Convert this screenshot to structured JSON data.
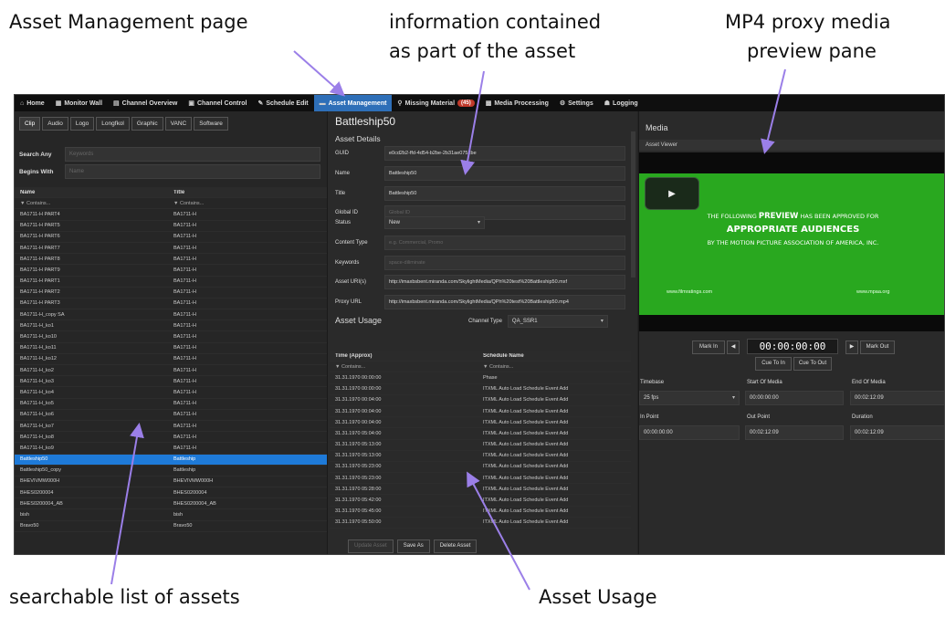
{
  "callouts": {
    "asset_management_page": "Asset Management page",
    "info_line1": "information contained",
    "info_line2": "as part of the asset",
    "proxy_line1": "MP4 proxy media",
    "proxy_line2": "preview pane",
    "searchable_list": "searchable list of assets",
    "asset_usage": "Asset Usage"
  },
  "colors": {
    "accent": "#1e7ad8",
    "annotation_arrow": "#9b7fe8",
    "preview_green": "#29a81f",
    "badge": "#c0392b"
  },
  "nav": {
    "items": [
      {
        "icon": "home-icon",
        "glyph": "⌂",
        "label": "Home"
      },
      {
        "icon": "monitor-wall-icon",
        "glyph": "▦",
        "label": "Monitor Wall"
      },
      {
        "icon": "channel-overview-icon",
        "glyph": "▤",
        "label": "Channel Overview"
      },
      {
        "icon": "channel-control-icon",
        "glyph": "▣",
        "label": "Channel Control"
      },
      {
        "icon": "schedule-edit-icon",
        "glyph": "✎",
        "label": "Schedule Edit"
      },
      {
        "icon": "asset-management-icon",
        "glyph": "▬",
        "label": "Asset Management"
      },
      {
        "icon": "missing-material-icon",
        "glyph": "⚲",
        "label": "Missing Material",
        "badge": "(45)"
      },
      {
        "icon": "media-processing-icon",
        "glyph": "▩",
        "label": "Media Processing"
      },
      {
        "icon": "settings-icon",
        "glyph": "⚙",
        "label": "Settings"
      },
      {
        "icon": "logging-icon",
        "glyph": "☗",
        "label": "Logging"
      }
    ]
  },
  "left": {
    "tabs": [
      "Clip",
      "Audio",
      "Logo",
      "Longfkol",
      "Graphic",
      "VANC",
      "Software"
    ],
    "search_any_label": "Search Any",
    "search_any_placeholder": "Keywords",
    "begins_with_label": "Begins With",
    "begins_with_placeholder": "Name",
    "col_name": "Name",
    "col_title": "Title",
    "filter_name": "▼ Contains...",
    "filter_title": "▼ Contains...",
    "rows": [
      [
        "BA1711-H PART4",
        "BA1711-H"
      ],
      [
        "BA1711-H PART5",
        "BA1711-H"
      ],
      [
        "BA1711-H PART6",
        "BA1711-H"
      ],
      [
        "BA1711-H PART7",
        "BA1711-H"
      ],
      [
        "BA1711-H PART8",
        "BA1711-H"
      ],
      [
        "BA1711-H PART9",
        "BA1711-H"
      ],
      [
        "BA1711-H PART1",
        "BA1711-H"
      ],
      [
        "BA1711-H PART2",
        "BA1711-H"
      ],
      [
        "BA1711-H PART3",
        "BA1711-H"
      ],
      [
        "BA1711-H_copy SA",
        "BA1711-H"
      ],
      [
        "BA1711-H_ko1",
        "BA1711-H"
      ],
      [
        "BA1711-H_ko10",
        "BA1711-H"
      ],
      [
        "BA1711-H_ko11",
        "BA1711-H"
      ],
      [
        "BA1711-H_ko12",
        "BA1711-H"
      ],
      [
        "BA1711-H_ko2",
        "BA1711-H"
      ],
      [
        "BA1711-H_ko3",
        "BA1711-H"
      ],
      [
        "BA1711-H_ko4",
        "BA1711-H"
      ],
      [
        "BA1711-H_ko5",
        "BA1711-H"
      ],
      [
        "BA1711-H_ko6",
        "BA1711-H"
      ],
      [
        "BA1711-H_ko7",
        "BA1711-H"
      ],
      [
        "BA1711-H_ko8",
        "BA1711-H"
      ],
      [
        "BA1711-H_ko9",
        "BA1711-H"
      ],
      [
        "Battleship50",
        "Battleship"
      ],
      [
        "Battleship50_copy",
        "Battleship"
      ],
      [
        "BHEVIVMW000H",
        "BHEVIVMW000H"
      ],
      [
        "BHES0200004",
        "BHES0200004"
      ],
      [
        "BHES0200004_AB",
        "BHES0200004_AB"
      ],
      [
        "bish",
        "bish"
      ],
      [
        "Bravo50",
        "Bravo50"
      ]
    ],
    "selected_index": 22
  },
  "details": {
    "title": "Battleship50",
    "section": "Asset Details",
    "fields": [
      {
        "label": "GUID",
        "value": "e0cd2b2-ffd-4d54-b2be-2b31ae0752be",
        "placeholder": false
      },
      {
        "label": "Name",
        "value": "Battleship50",
        "placeholder": false
      },
      {
        "label": "Title",
        "value": "Battleship50",
        "placeholder": false
      },
      {
        "label": "Global ID",
        "value": "Global ID",
        "placeholder": true
      }
    ],
    "status_label": "Status",
    "status_value": "New",
    "fields2": [
      {
        "label": "Content Type",
        "value": "e.g. Commercial, Promo",
        "placeholder": true
      },
      {
        "label": "Keywords",
        "value": "space-diliminate",
        "placeholder": true
      },
      {
        "label": "Asset URI(s)",
        "value": "http://imaxbsbent.miranda.com/SkylightMedia/QPh%20test%20Battleship50.mxf",
        "placeholder": false
      },
      {
        "label": "Proxy URL",
        "value": "http://imaxbsbent.miranda.com/SkylightMedia/QPh%20test%20Battleship50.mp4",
        "placeholder": false
      }
    ],
    "usage_title": "Asset Usage",
    "channel_type_label": "Channel Type",
    "channel_type_value": "QA_SSR1",
    "usage_col_time": "Time (Approx)",
    "usage_col_schedule": "Schedule Name",
    "usage_filter_time": "▼ Contains...",
    "usage_filter_schedule": "▼ Contains...",
    "usage_rows": [
      [
        "31.31.1970 00:00:00",
        "Phase"
      ],
      [
        "31.31.1970 00:00:00",
        "ITXML Auto Load Schedule Event Add"
      ],
      [
        "31.31.1970 00:04:00",
        "ITXML Auto Load Schedule Event Add"
      ],
      [
        "31.31.1970 00:04:00",
        "ITXML Auto Load Schedule Event Add"
      ],
      [
        "31.31.1970 00:04:00",
        "ITXML Auto Load Schedule Event Add"
      ],
      [
        "31.31.1970 05:04:00",
        "ITXML Auto Load Schedule Event Add"
      ],
      [
        "31.31.1970 05:13:00",
        "ITXML Auto Load Schedule Event Add"
      ],
      [
        "31.31.1970 05:13:00",
        "ITXML Auto Load Schedule Event Add"
      ],
      [
        "31.31.1970 05:23:00",
        "ITXML Auto Load Schedule Event Add"
      ],
      [
        "31.31.1970 05:23:00",
        "ITXML Auto Load Schedule Event Add"
      ],
      [
        "31.31.1970 05:28:00",
        "ITXML Auto Load Schedule Event Add"
      ],
      [
        "31.31.1970 05:42:00",
        "ITXML Auto Load Schedule Event Add"
      ],
      [
        "31.31.1970 05:45:00",
        "ITXML Auto Load Schedule Event Add"
      ],
      [
        "31.31.1970 05:50:00",
        "ITXML Auto Load Schedule Event Add"
      ]
    ],
    "btn_update": "Update Asset",
    "btn_save_as": "Save As",
    "btn_delete": "Delete Asset"
  },
  "media": {
    "title": "Media",
    "viewer_label": "Asset Viewer",
    "play_glyph": "▶",
    "preview_line1a": "THE FOLLOWING",
    "preview_word": "PREVIEW",
    "preview_line1b": "HAS BEEN APPROVED FOR",
    "preview_line2": "APPROPRIATE AUDIENCES",
    "preview_line3": "BY THE MOTION PICTURE ASSOCIATION OF AMERICA, INC.",
    "url_left": "www.filmratings.com",
    "url_right": "www.mpaa.org",
    "mark_in": "Mark In",
    "step_back": "◀",
    "timecode": "00:00:00:00",
    "step_fwd": "▶",
    "mark_out": "Mark Out",
    "cue_to_in": "Cue To In",
    "cue_to_out": "Cue To Out",
    "timebase_label": "Timebase",
    "timebase_value": "25 fps",
    "som_label": "Start Of Media",
    "som_value": "00:00:00:00",
    "eom_label": "End Of Media",
    "eom_value": "00:02:12:09",
    "in_label": "In Point",
    "in_value": "00:00:00:00",
    "out_label": "Out Point",
    "out_value": "00:02:12:09",
    "dur_label": "Duration",
    "dur_value": "00:02:12:09"
  }
}
